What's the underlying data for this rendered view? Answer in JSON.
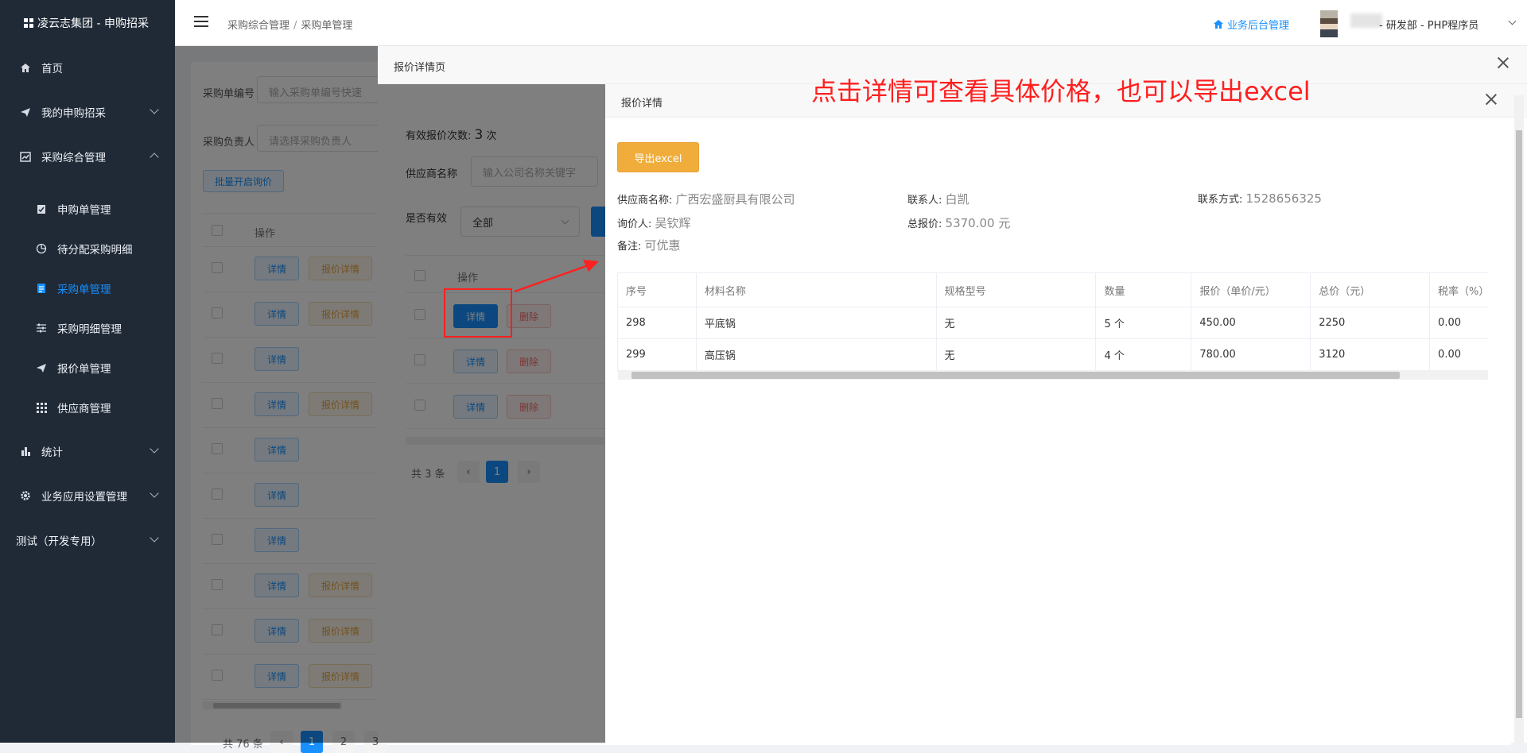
{
  "app": {
    "brand": "凌云志集团 - 申购招采"
  },
  "sidebar": {
    "items": [
      {
        "label": "首页",
        "icon": "home-icon"
      },
      {
        "label": "我的申购招采",
        "icon": "send-icon"
      },
      {
        "label": "采购综合管理",
        "icon": "chart-icon"
      },
      {
        "label": "申购单管理",
        "icon": "clipboard-icon"
      },
      {
        "label": "待分配采购明细",
        "icon": "pie-icon"
      },
      {
        "label": "采购单管理",
        "icon": "document-icon"
      },
      {
        "label": "采购明细管理",
        "icon": "sliders-icon"
      },
      {
        "label": "报价单管理",
        "icon": "send-icon"
      },
      {
        "label": "供应商管理",
        "icon": "grid-icon"
      },
      {
        "label": "统计",
        "icon": "bar-chart-icon"
      },
      {
        "label": "业务应用设置管理",
        "icon": "gear-icon"
      },
      {
        "label": "测试（开发专用）",
        "icon": ""
      }
    ]
  },
  "header": {
    "breadcrumb": [
      "采购综合管理",
      "采购单管理"
    ],
    "biz_link": "业务后台管理",
    "user_suffix": "- 研发部 - PHP程序员"
  },
  "page": {
    "search_label_1": "采购单编号",
    "search_placeholder_1": "输入采购单编号快速",
    "search_label_2": "采购负责人",
    "search_placeholder_2": "请选择采购负责人",
    "batch_button": "批量开启询价",
    "col_action": "操作",
    "btn_detail": "详情",
    "btn_quote_detail": "报价详情",
    "total_text": "共 76 条",
    "pages": [
      "1",
      "2",
      "3"
    ]
  },
  "dialog1": {
    "title": "报价详情页",
    "valid_count_label": "有效报价次数:",
    "valid_count_value": "3",
    "valid_count_unit": "次",
    "supplier_label": "供应商名称",
    "supplier_placeholder": "输入公司名称关键字",
    "valid_label": "是否有效",
    "valid_select": "全部",
    "col_action": "操作",
    "btn_detail": "详情",
    "btn_delete": "删除",
    "total_text": "共 3 条",
    "current_page": "1"
  },
  "dialog2": {
    "title": "报价详情",
    "export_button": "导出excel",
    "supplier_name_label": "供应商名称:",
    "supplier_name": "广西宏盛厨具有限公司",
    "contact_label": "联系人:",
    "contact": "白凯",
    "phone_label": "联系方式:",
    "phone": "1528656325",
    "inquirer_label": "询价人:",
    "inquirer": "吴钦辉",
    "total_price_label": "总报价:",
    "total_price": "5370.00 元",
    "remark_label": "备注:",
    "remark": "可优惠",
    "columns": [
      "序号",
      "材料名称",
      "规格型号",
      "数量",
      "报价（单价/元）",
      "总价（元）",
      "税率（%）"
    ],
    "rows": [
      [
        "298",
        "平底锅",
        "无",
        "5 个",
        "450.00",
        "2250",
        "0.00"
      ],
      [
        "299",
        "高压锅",
        "无",
        "4 个",
        "780.00",
        "3120",
        "0.00"
      ]
    ]
  },
  "annotation": "点击详情可查看具体价格，也可以导出excel",
  "colors": {
    "primary": "#1890ff",
    "sidebar": "#202a37",
    "warning": "#e6a23c",
    "danger": "#f56c6c",
    "annotation": "#ff1f1f"
  }
}
